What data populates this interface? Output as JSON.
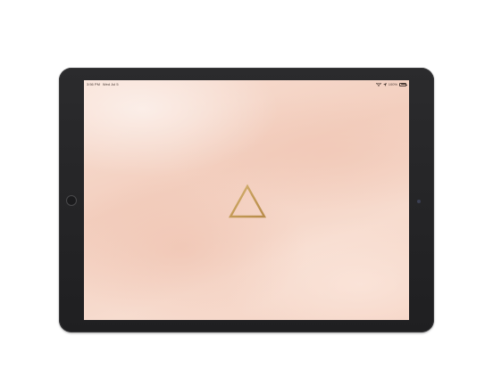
{
  "status_bar": {
    "time": "3:56 PM",
    "date": "Wed Jul 5",
    "battery_text": "100%",
    "battery_level": 1.0,
    "icons": [
      "wifi-icon",
      "location-icon",
      "battery-icon"
    ]
  },
  "wallpaper": {
    "colors": [
      "#f8dfd3",
      "#f3cfbf",
      "#f4d2c3"
    ],
    "emblem": "air-element-triangle-icon",
    "emblem_color": "#c9a45c"
  },
  "device": {
    "frame_color": "#262628",
    "orientation": "landscape"
  }
}
